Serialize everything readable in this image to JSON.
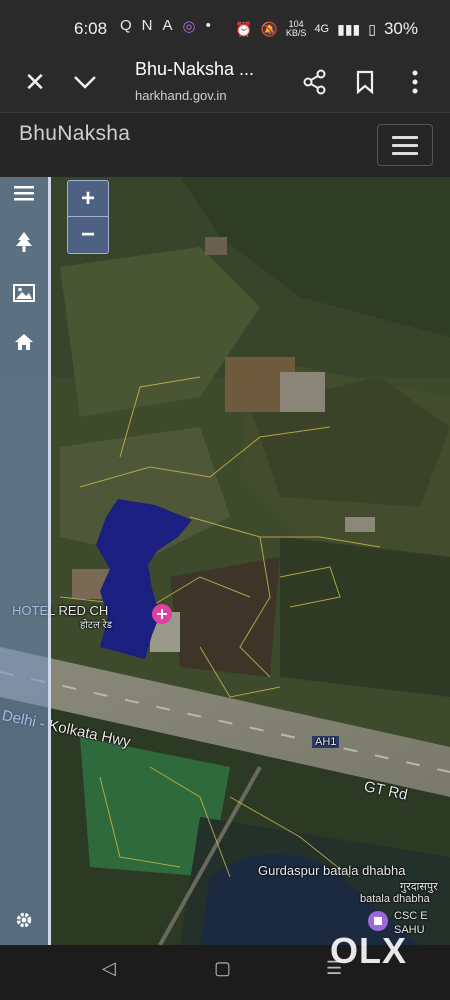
{
  "status_bar": {
    "time": "6:08",
    "speed": "104",
    "speed_unit": "KB/S",
    "network": "4G",
    "battery": "30%"
  },
  "browser": {
    "title": "Bhu-Naksha ...",
    "url": "harkhand.gov.in"
  },
  "app": {
    "brand": "BhuNaksha"
  },
  "map": {
    "zoom_in_label": "+",
    "zoom_out_label": "−",
    "labels": {
      "hotel": "HOTEL RED CH",
      "hotel_hindi": "होटल रेड",
      "highway": "Delhi - Kolkata Hwy",
      "ah1": "AH1",
      "gt_rd": "GT Rd",
      "dhabha": "Gurdaspur batala dhabha",
      "dhabha_hindi_1": "गुरदासपुर",
      "dhabha_hindi_2": "batala dhabha",
      "csc": "CSC E",
      "sahu": "SAHU"
    },
    "plot_color": "#1a1f80"
  },
  "watermark": "OLX"
}
